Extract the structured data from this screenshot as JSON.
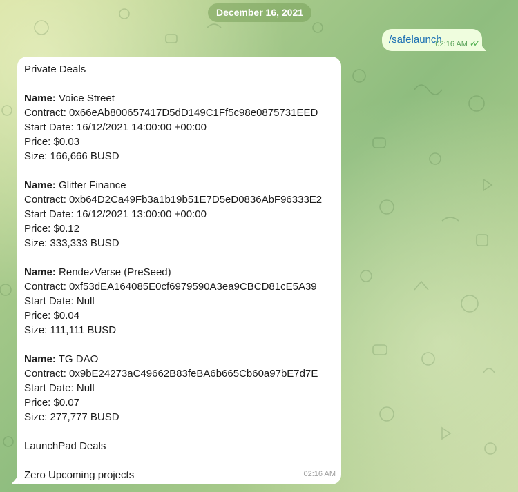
{
  "date_separator": "December 16, 2021",
  "outgoing_message": {
    "text": "/safelaunch",
    "time": "02:16 AM",
    "status_icon": "double-check-icon"
  },
  "incoming_message": {
    "time": "02:16 AM",
    "heading": "Private Deals",
    "deals": [
      {
        "name_label": "Name:",
        "name": "Voice Street",
        "contract": "Contract: 0x66eAb800657417D5dD149C1Ff5c98e0875731EED",
        "start": "Start Date: 16/12/2021 14:00:00 +00:00",
        "price": "Price: $0.03",
        "size": "Size: 166,666 BUSD"
      },
      {
        "name_label": "Name:",
        "name": "Glitter Finance",
        "contract": "Contract: 0xb64D2Ca49Fb3a1b19b51E7D5eD0836AbF96333E2",
        "start": "Start Date: 16/12/2021 13:00:00 +00:00",
        "price": "Price: $0.12",
        "size": "Size: 333,333 BUSD"
      },
      {
        "name_label": "Name:",
        "name": "RendezVerse (PreSeed)",
        "contract": "Contract: 0xf53dEA164085E0cf6979590A3ea9CBCD81cE5A39",
        "start": "Start Date: Null",
        "price": "Price: $0.04",
        "size": "Size: 111,111 BUSD"
      },
      {
        "name_label": "Name:",
        "name": "TG DAO",
        "contract": "Contract: 0x9bE24273aC49662B83feBA6b665Cb60a97bE7d7E",
        "start": "Start Date: Null",
        "price": "Price: $0.07",
        "size": "Size: 277,777 BUSD"
      }
    ],
    "launchpad_heading": "LaunchPad Deals",
    "launchpad_status": "Zero Upcoming projects"
  }
}
